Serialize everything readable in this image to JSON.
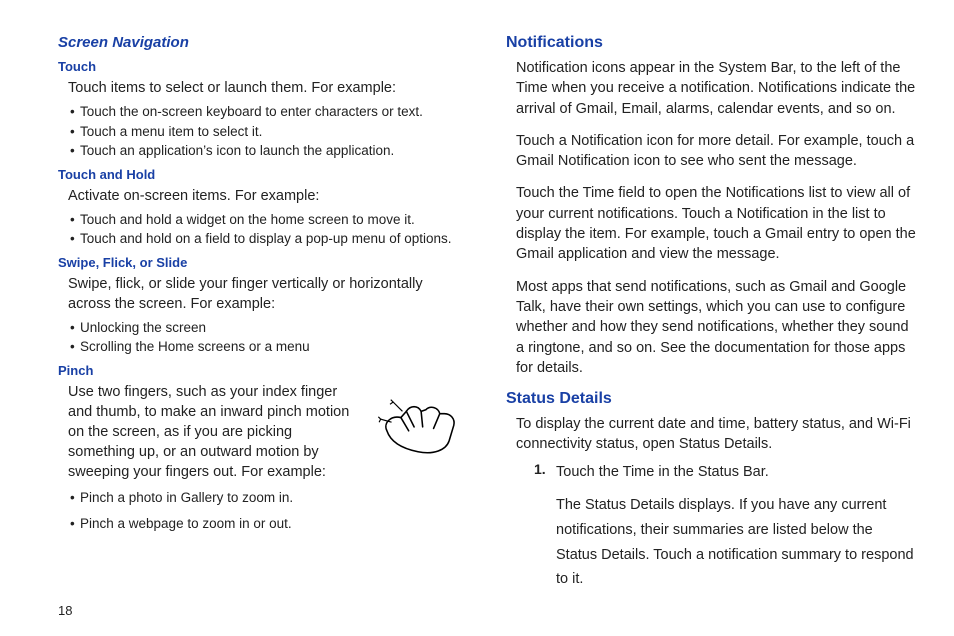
{
  "pageNumber": "18",
  "left": {
    "nav_heading": "Screen Navigation",
    "touch": {
      "h": "Touch",
      "intro": "Touch items to select or launch them. For example:",
      "items": [
        "Touch the on-screen keyboard to enter characters or text.",
        "Touch a menu item to select it.",
        "Touch an application’s icon to launch the application."
      ]
    },
    "hold": {
      "h": "Touch and Hold",
      "intro": "Activate on-screen items. For example:",
      "items": [
        "Touch and hold a widget on the home screen to move it.",
        "Touch and hold on a field to display a pop-up menu of options."
      ]
    },
    "swipe": {
      "h": "Swipe, Flick, or Slide",
      "intro": "Swipe, flick, or slide your finger vertically or horizontally across the screen. For example:",
      "items": [
        "Unlocking the screen",
        "Scrolling the Home screens or a menu"
      ]
    },
    "pinch": {
      "h": "Pinch",
      "intro": "Use two fingers, such as your index finger and thumb, to make an inward pinch motion on the screen, as if you are picking something up, or an outward motion by sweeping your fingers out. For example:",
      "items": [
        "Pinch a photo in Gallery to zoom in.",
        "Pinch a webpage to zoom in or out."
      ]
    }
  },
  "right": {
    "notif": {
      "h": "Notifications",
      "p1": "Notification icons appear in the System Bar, to the left of the Time when you receive a notification. Notifications indicate the arrival of Gmail, Email, alarms, calendar events, and so on.",
      "p2": "Touch a Notification icon for more detail. For example, touch a Gmail Notification icon to see who sent the message.",
      "p3": "Touch the Time field to open the Notifications list to view all of your current notifications. Touch a Notification in the list to display the item. For example, touch a Gmail entry to open the Gmail application and view the message.",
      "p4": "Most apps that send notifications, such as Gmail and Google Talk, have their own settings, which you can use to configure whether and how they send notifications, whether they sound a ringtone, and so on. See the documentation for those apps for details."
    },
    "status": {
      "h": "Status Details",
      "intro": "To display the current date and time, battery status, and Wi-Fi connectivity status, open Status Details.",
      "step1_num": "1.",
      "step1": "Touch the Time in the Status Bar.",
      "step1b": "The Status Details displays. If you have any current notifications, their summaries are listed below the Status Details. Touch a notification summary to respond to it."
    }
  }
}
